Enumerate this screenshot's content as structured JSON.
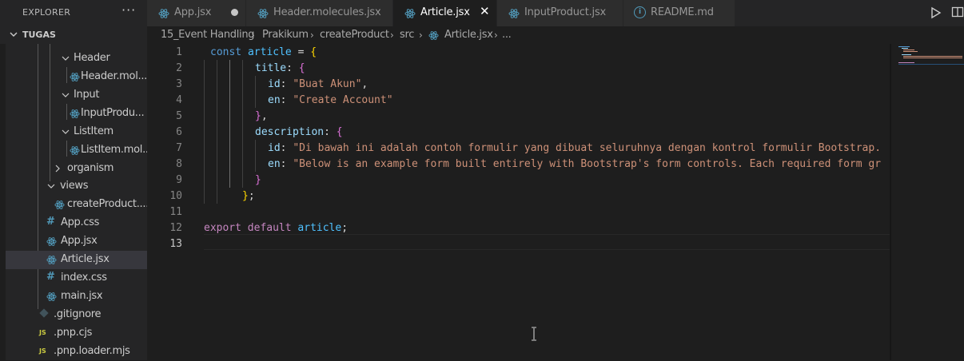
{
  "explorer": {
    "title": "EXPLORER",
    "more_icon": "ellipsis-icon",
    "section": "TUGAS",
    "items": [
      {
        "label": "Header",
        "type": "folder",
        "expanded": true
      },
      {
        "label": "Header.mol...",
        "type": "react"
      },
      {
        "label": "Input",
        "type": "folder",
        "expanded": true
      },
      {
        "label": "InputProdu...",
        "type": "react"
      },
      {
        "label": "ListItem",
        "type": "folder",
        "expanded": true
      },
      {
        "label": "ListItem.mol...",
        "type": "react"
      },
      {
        "label": "organism",
        "type": "folder",
        "expanded": false
      },
      {
        "label": "views",
        "type": "folder",
        "expanded": true
      },
      {
        "label": "createProduct....",
        "type": "react"
      },
      {
        "label": "App.css",
        "type": "css"
      },
      {
        "label": "App.jsx",
        "type": "react"
      },
      {
        "label": "Article.jsx",
        "type": "react",
        "selected": true
      },
      {
        "label": "index.css",
        "type": "css"
      },
      {
        "label": "main.jsx",
        "type": "react"
      },
      {
        "label": ".gitignore",
        "type": "git"
      },
      {
        "label": ".pnp.cjs",
        "type": "js",
        "badge": "JS"
      },
      {
        "label": ".pnp.loader.mjs",
        "type": "js",
        "badge": "JS"
      }
    ]
  },
  "tabs": [
    {
      "label": "App.jsx",
      "icon": "react-icon",
      "modified": true
    },
    {
      "label": "Header.molecules.jsx",
      "icon": "react-icon"
    },
    {
      "label": "Article.jsx",
      "icon": "react-icon",
      "active": true,
      "close": "✕"
    },
    {
      "label": "InputProduct.jsx",
      "icon": "react-icon"
    },
    {
      "label": "README.md",
      "icon": "info-icon",
      "info": "i"
    }
  ],
  "toolbar": {
    "run_icon": "play-icon",
    "split_icon": "split-editor-icon"
  },
  "breadcrumb": [
    "15_Event Handling",
    "Prakikum",
    "createProduct",
    "src",
    "Article.jsx",
    "..."
  ],
  "editor": {
    "line_numbers": [
      "1",
      "2",
      "3",
      "4",
      "5",
      "6",
      "7",
      "8",
      "9",
      "10",
      "11",
      "12",
      "13"
    ],
    "current_line": "13",
    "lines": [
      [
        {
          "t": "const ",
          "c": "kw"
        },
        {
          "t": "article",
          "c": "var"
        },
        {
          "t": " = ",
          "c": "punc"
        },
        {
          "t": "{",
          "c": "b1"
        }
      ],
      [
        {
          "t": "title",
          "c": "prop"
        },
        {
          "t": ": ",
          "c": "punc"
        },
        {
          "t": "{",
          "c": "b2"
        }
      ],
      [
        {
          "t": "id",
          "c": "prop"
        },
        {
          "t": ": ",
          "c": "punc"
        },
        {
          "t": "\"Buat Akun\"",
          "c": "str"
        },
        {
          "t": ",",
          "c": "punc"
        }
      ],
      [
        {
          "t": "en",
          "c": "prop"
        },
        {
          "t": ": ",
          "c": "punc"
        },
        {
          "t": "\"Create Account\"",
          "c": "str"
        }
      ],
      [
        {
          "t": "}",
          "c": "b2"
        },
        {
          "t": ",",
          "c": "punc"
        }
      ],
      [
        {
          "t": "description",
          "c": "prop"
        },
        {
          "t": ": ",
          "c": "punc"
        },
        {
          "t": "{",
          "c": "b2"
        }
      ],
      [
        {
          "t": "id",
          "c": "prop"
        },
        {
          "t": ": ",
          "c": "punc"
        },
        {
          "t": "\"Di bawah ini adalah contoh formulir yang dibuat seluruhnya dengan kontrol formulir Bootstrap.",
          "c": "str"
        }
      ],
      [
        {
          "t": "en",
          "c": "prop"
        },
        {
          "t": ": ",
          "c": "punc"
        },
        {
          "t": "\"Below is an example form built entirely with Bootstrap",
          "c": "str"
        },
        {
          "t": "'",
          "c": "str"
        },
        {
          "t": "s form controls. Each required form gr",
          "c": "str"
        }
      ],
      [
        {
          "t": "}",
          "c": "b2"
        }
      ],
      [
        {
          "t": "}",
          "c": "b1"
        },
        {
          "t": ";",
          "c": "punc"
        }
      ],
      [],
      [
        {
          "t": "export ",
          "c": "kw2"
        },
        {
          "t": "default ",
          "c": "kw2"
        },
        {
          "t": "article",
          "c": "var"
        },
        {
          "t": ";",
          "c": "punc"
        }
      ],
      []
    ]
  },
  "colors": {
    "accent": "#007acc",
    "react": "#519aba",
    "selection": "#37373d"
  }
}
